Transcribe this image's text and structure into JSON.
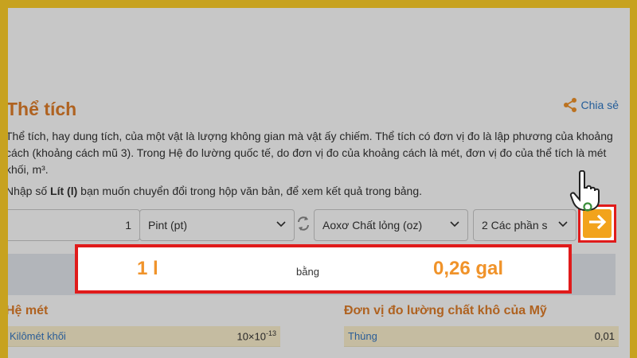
{
  "page": {
    "title": "Thể tích",
    "share_label": "Chia sẻ",
    "description": "Thể tích, hay dung tích, của một vật là lượng không gian mà vật ấy chiếm. Thể tích có đơn vị đo là lập phương của khoảng cách (khoảng cách mũ 3). Trong Hệ đo lường quốc tế, do đơn vị đo của khoảng cách là mét, đơn vị đo của thể tích là mét khối, m³.",
    "instruction_prefix": "Nhập số ",
    "instruction_unit": "Lít (l)",
    "instruction_suffix": " bạn muốn chuyển đổi trong hộp văn bản, để xem kết quả trong bảng."
  },
  "converter": {
    "input_value": "1",
    "from_unit": "Pint (pt)",
    "to_unit": "Aoxơ Chất lỏng (oz)",
    "precision": "2 Các phần s"
  },
  "result": {
    "left": "1 l",
    "middle": "bằng",
    "right": "0,26 gal"
  },
  "sections": {
    "left": {
      "title": "Hệ mét",
      "row_name": "Kilômét khối",
      "row_value_base": "10×10",
      "row_value_exp": "-13"
    },
    "right": {
      "title": "Đơn vị đo lường chất khô của Mỹ",
      "row_name": "Thùng",
      "row_value": "0,01"
    }
  },
  "colors": {
    "frame": "#c7a21f",
    "accent_orange": "#e07e2a",
    "highlight_red": "#e01b1b",
    "go_button": "#f2a31c",
    "link_blue": "#2f78c4"
  },
  "icons": {
    "share": "share-icon",
    "swap": "swap-icon",
    "go": "arrow-right-icon",
    "hand": "pointing-hand-icon",
    "dropdown": "chevron-down-icon"
  }
}
